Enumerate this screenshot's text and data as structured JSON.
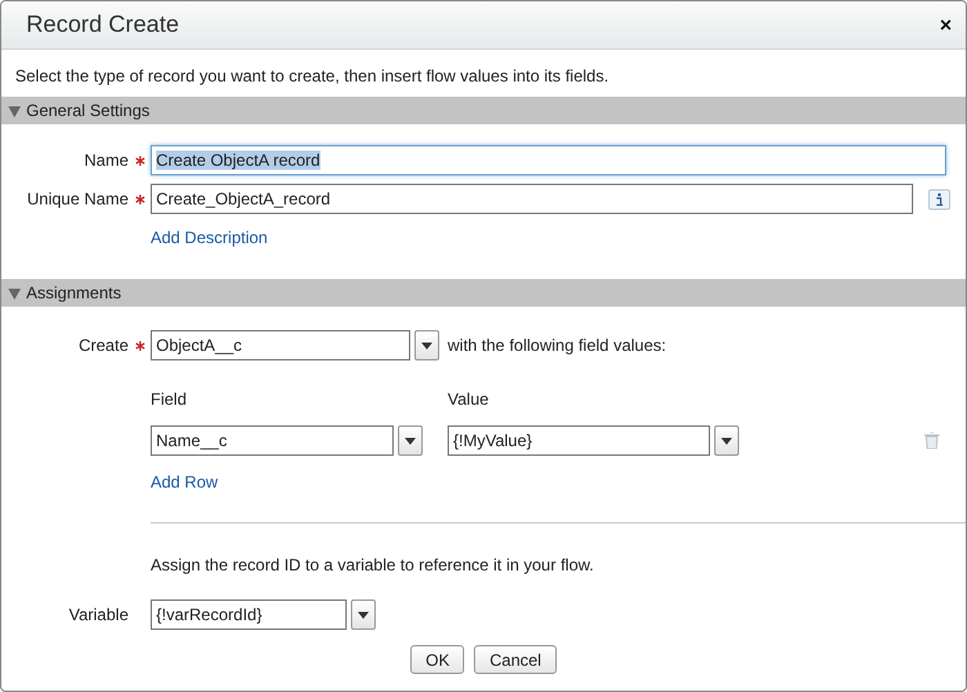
{
  "window": {
    "title": "Record Create",
    "close": "×"
  },
  "intro": "Select the type of record you want to create, then insert flow values into its fields.",
  "sections": [
    {
      "title": "General Settings",
      "expanded": true,
      "kind": "general",
      "fields": [
        {
          "label": "Name",
          "required": true,
          "value": "Create ObjectA record",
          "focused": true,
          "info": false
        },
        {
          "label": "Unique Name",
          "required": true,
          "value": "Create_ObjectA_record",
          "focused": false,
          "info": true
        }
      ],
      "link": "Add Description"
    },
    {
      "title": "Assignments",
      "expanded": true,
      "kind": "assignments",
      "create": {
        "label": "Create",
        "required": true,
        "value": "ObjectA__c",
        "suffix": "with the following field values:"
      },
      "columns": [
        "Field",
        "Value"
      ],
      "rows": [
        {
          "field": "Name__c",
          "value": "{!MyValue}"
        }
      ],
      "link": "Add Row",
      "note": "Assign the record ID to a variable to reference it in your flow.",
      "variable": {
        "label": "Variable",
        "required": false,
        "value": "{!varRecordId}"
      }
    }
  ],
  "buttons": [
    "OK",
    "Cancel"
  ]
}
